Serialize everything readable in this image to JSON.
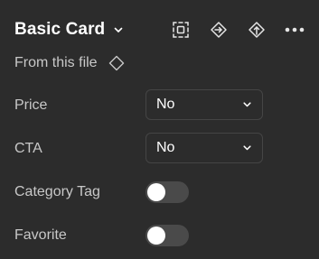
{
  "component": {
    "title": "Basic Card"
  },
  "header_icons": [
    "select-variant-icon",
    "go-to-main-component-icon",
    "push-changes-icon",
    "more-icon"
  ],
  "source": {
    "label": "From this file",
    "icon": "component-diamond-icon"
  },
  "properties": {
    "price": {
      "label": "Price",
      "value": "No"
    },
    "cta": {
      "label": "CTA",
      "value": "No"
    },
    "category_tag": {
      "label": "Category Tag",
      "on": false
    },
    "favorite": {
      "label": "Favorite",
      "on": false
    }
  },
  "colors": {
    "background": "#2c2c2c",
    "text_primary": "#ffffff",
    "text_secondary": "#c8c8c8",
    "border": "#454545",
    "toggle_off": "#4a4a4a"
  }
}
